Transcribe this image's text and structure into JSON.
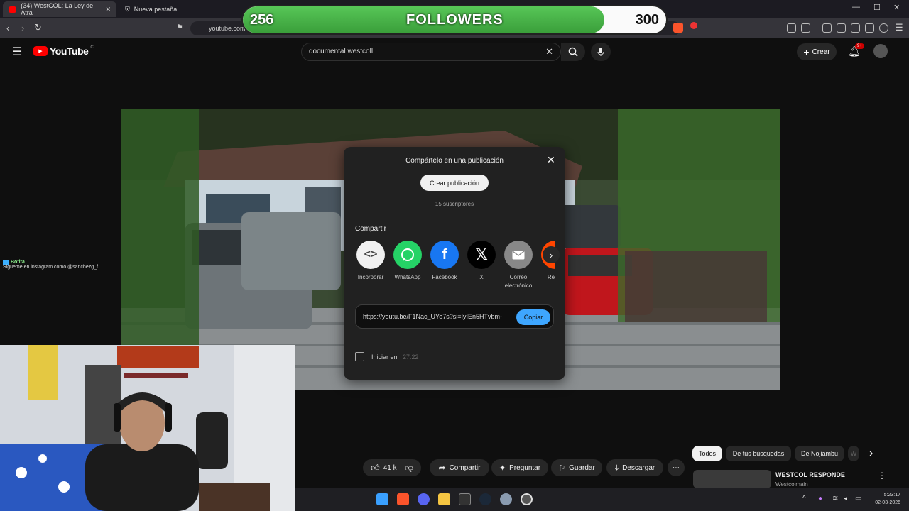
{
  "browser": {
    "tabs": [
      {
        "label": "(34) WestCOL: La Ley de Atra"
      },
      {
        "label": "Nueva pestaña"
      }
    ],
    "url": "youtube.com"
  },
  "followers": {
    "current": "256",
    "label": "FOLLOWERS",
    "goal": "300",
    "progress": 0.8533
  },
  "youtube": {
    "logo_text": "YouTube",
    "country": "CL",
    "search_value": "documental westcoll",
    "create_label": "Crear",
    "notification_badge": "9+"
  },
  "share_dialog": {
    "title": "Compártelo en una publicación",
    "create_post_label": "Crear publicación",
    "subscribers": "15 suscriptores",
    "share_heading": "Compartir",
    "targets": [
      {
        "label": "Incorporar",
        "icon": "embed-icon",
        "color": "#f1f1f1"
      },
      {
        "label": "WhatsApp",
        "icon": "whatsapp-icon",
        "color": "#25d366"
      },
      {
        "label": "Facebook",
        "icon": "facebook-icon",
        "color": "#1877f2"
      },
      {
        "label": "X",
        "icon": "x-icon",
        "color": "#000000"
      },
      {
        "label": "Correo electrónico",
        "icon": "email-icon",
        "color": "#888888"
      },
      {
        "label": "Re",
        "icon": "reddit-icon",
        "color": "#ff4500"
      }
    ],
    "link": "https://youtu.be/F1Nac_UYo7s?si=IyIEn5HTvbm-",
    "copy_label": "Copiar",
    "start_at_label": "Iniciar en",
    "start_at_time": "27:22"
  },
  "chat_overlay": {
    "user": "Botita",
    "message": "Sigueme en instagram como @sanchezg_f"
  },
  "actions": {
    "likes": "41 k",
    "share": "Compartir",
    "ask": "Preguntar",
    "save": "Guardar",
    "download": "Descargar"
  },
  "chips": [
    "Todos",
    "De tus búsquedas",
    "De Nojiambu",
    "W"
  ],
  "recommendation": {
    "title": "WESTCOL RESPONDE",
    "channel": "Westcolmain"
  },
  "taskbar": {
    "time": "5:23:17",
    "date": "02-03-2026"
  }
}
